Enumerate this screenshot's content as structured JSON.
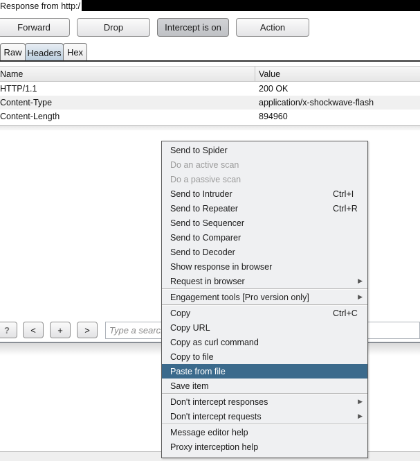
{
  "window": {
    "title": "Response from http:/"
  },
  "toolbar": {
    "forward": "Forward",
    "drop": "Drop",
    "intercept": "Intercept is on",
    "action": "Action"
  },
  "tabs": [
    {
      "label": "Raw",
      "selected": false
    },
    {
      "label": "Headers",
      "selected": true
    },
    {
      "label": "Hex",
      "selected": false
    }
  ],
  "headers_table": {
    "columns": [
      "Name",
      "Value"
    ],
    "rows": [
      {
        "name": "HTTP/1.1",
        "value": "200 OK"
      },
      {
        "name": "Content-Type",
        "value": "application/x-shockwave-flash"
      },
      {
        "name": "Content-Length",
        "value": "894960"
      }
    ]
  },
  "search_bar": {
    "help": "?",
    "prev": "<",
    "add": "+",
    "next": ">",
    "placeholder": "Type a search term"
  },
  "context_menu": {
    "highlight_color": "#3b6a8c",
    "items": [
      {
        "label": "Send to Spider"
      },
      {
        "label": "Do an active scan",
        "disabled": true
      },
      {
        "label": "Do a passive scan",
        "disabled": true
      },
      {
        "label": "Send to Intruder",
        "shortcut": "Ctrl+I"
      },
      {
        "label": "Send to Repeater",
        "shortcut": "Ctrl+R"
      },
      {
        "label": "Send to Sequencer"
      },
      {
        "label": "Send to Comparer"
      },
      {
        "label": "Send to Decoder"
      },
      {
        "label": "Show response in browser"
      },
      {
        "label": "Request in browser",
        "submenu": true
      },
      {
        "label": "Engagement tools [Pro version only]",
        "submenu": true
      },
      {
        "label": "Copy",
        "shortcut": "Ctrl+C"
      },
      {
        "label": "Copy URL"
      },
      {
        "label": "Copy as curl command"
      },
      {
        "label": "Copy to file"
      },
      {
        "label": "Paste from file",
        "highlighted": true
      },
      {
        "label": "Save item"
      },
      {
        "label": "Don't intercept responses",
        "submenu": true
      },
      {
        "label": "Don't intercept requests",
        "submenu": true
      },
      {
        "label": "Message editor help"
      },
      {
        "label": "Proxy interception help"
      }
    ],
    "submenu_arrow": "▶"
  }
}
